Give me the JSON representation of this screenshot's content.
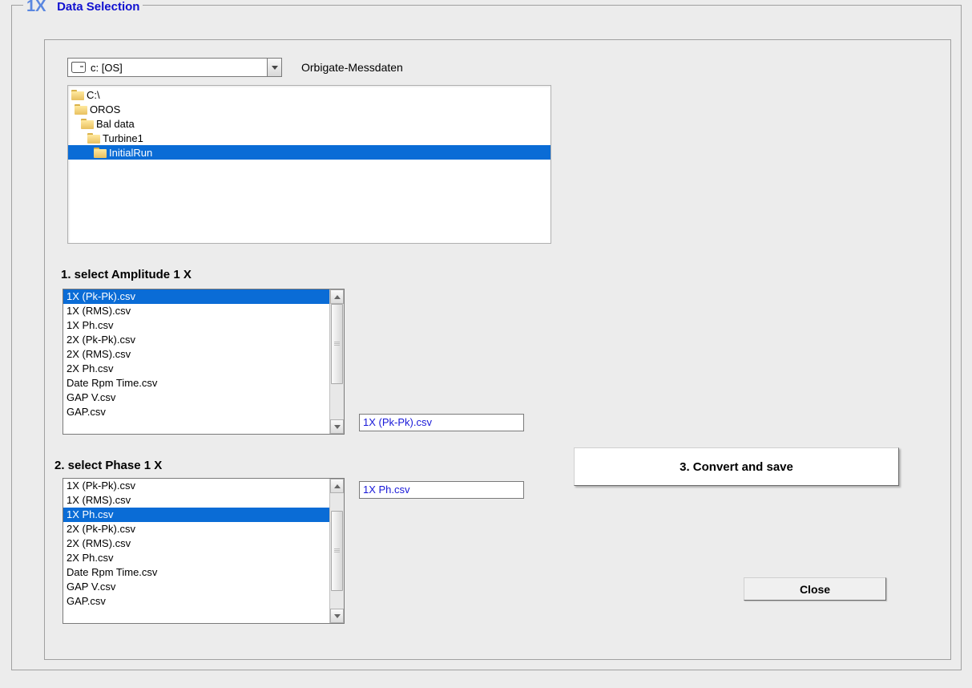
{
  "legend": {
    "prefix": "1X",
    "title": "Data Selection"
  },
  "drive": {
    "text": "c: [OS]"
  },
  "side_label": "Orbigate-Messdaten",
  "tree": [
    {
      "label": "C:\\",
      "indent": 4,
      "selected": false
    },
    {
      "label": "OROS",
      "indent": 8,
      "selected": false
    },
    {
      "label": "Bal data",
      "indent": 16,
      "selected": false
    },
    {
      "label": "Turbine1",
      "indent": 24,
      "selected": false
    },
    {
      "label": "InitialRun",
      "indent": 32,
      "selected": true
    }
  ],
  "section_amp_label": "1. select Amplitude  1 X",
  "section_phase_label": "2. select     Phase  1 X",
  "file_list": [
    "1X (Pk-Pk).csv",
    "1X (RMS).csv",
    "1X Ph.csv",
    "2X (Pk-Pk).csv",
    "2X (RMS).csv",
    "2X Ph.csv",
    "Date Rpm Time.csv",
    "GAP V.csv",
    "GAP.csv"
  ],
  "amp_selected_index": 0,
  "phase_selected_index": 2,
  "amp_textbox": "1X (Pk-Pk).csv",
  "phase_textbox": "1X Ph.csv",
  "buttons": {
    "convert": "3. Convert and save",
    "close": "Close"
  }
}
